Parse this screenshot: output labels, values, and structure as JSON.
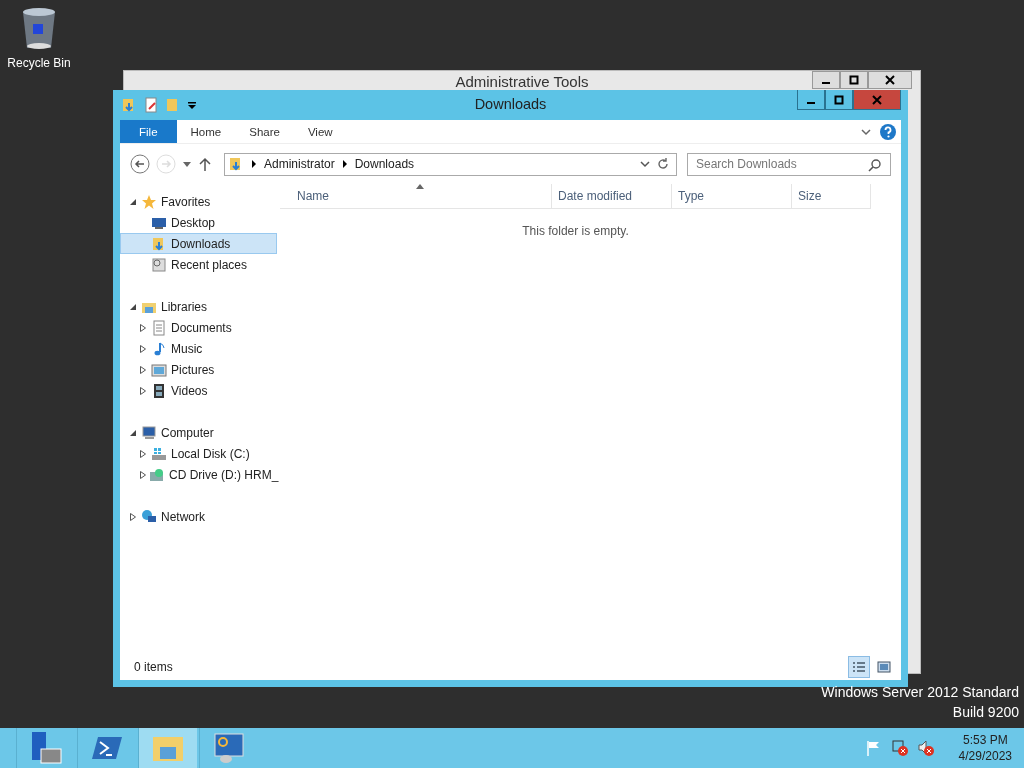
{
  "desktop_icons": [
    {
      "label": "Recycle Bin",
      "kind": "recycle"
    }
  ],
  "back_window": {
    "title": "Administrative Tools"
  },
  "window": {
    "title": "Downloads"
  },
  "ribbon_tabs": [
    {
      "label": "File",
      "selected": true
    },
    {
      "label": "Home",
      "selected": false
    },
    {
      "label": "Share",
      "selected": false
    },
    {
      "label": "View",
      "selected": false
    }
  ],
  "address": {
    "crumbs": [
      "Administrator",
      "Downloads"
    ]
  },
  "search": {
    "placeholder": "Search Downloads"
  },
  "nav": [
    {
      "label": "Favorites",
      "kind": "star",
      "expanded": true,
      "children": [
        {
          "label": "Desktop",
          "kind": "desktop",
          "selected": false
        },
        {
          "label": "Downloads",
          "kind": "downloads",
          "selected": true
        },
        {
          "label": "Recent places",
          "kind": "recent",
          "selected": false
        }
      ]
    },
    {
      "label": "Libraries",
      "kind": "library",
      "expanded": true,
      "children": [
        {
          "label": "Documents",
          "kind": "document",
          "expanded": false,
          "selected": false
        },
        {
          "label": "Music",
          "kind": "music",
          "expanded": false,
          "selected": false
        },
        {
          "label": "Pictures",
          "kind": "pictures",
          "expanded": false,
          "selected": false
        },
        {
          "label": "Videos",
          "kind": "videos",
          "expanded": false,
          "selected": false
        }
      ]
    },
    {
      "label": "Computer",
      "kind": "computer",
      "expanded": true,
      "children": [
        {
          "label": "Local Disk (C:)",
          "kind": "disk",
          "expanded": false,
          "selected": false
        },
        {
          "label": "CD Drive (D:) HRM_",
          "kind": "cd",
          "expanded": false,
          "selected": false
        }
      ]
    },
    {
      "label": "Network",
      "kind": "network",
      "expanded": false
    }
  ],
  "columns": [
    {
      "label": "Name",
      "sorted": true
    },
    {
      "label": "Date modified",
      "sorted": false
    },
    {
      "label": "Type",
      "sorted": false
    },
    {
      "label": "Size",
      "sorted": false
    }
  ],
  "empty_message": "This folder is empty.",
  "status_bar": {
    "count": "0 items"
  },
  "view_buttons": [
    {
      "kind": "details",
      "selected": true
    },
    {
      "kind": "large",
      "selected": false
    }
  ],
  "os_label": [
    "Windows Server 2012 Standard",
    "Build 9200"
  ],
  "taskbar": [
    {
      "kind": "server",
      "selected": false
    },
    {
      "kind": "powershell",
      "selected": false
    },
    {
      "kind": "explorer",
      "selected": true
    },
    {
      "kind": "control",
      "selected": false
    }
  ],
  "tray": [
    {
      "kind": "flag"
    },
    {
      "kind": "network"
    },
    {
      "kind": "sound"
    }
  ],
  "clock": {
    "time": "5:53 PM",
    "date": "4/29/2023"
  }
}
